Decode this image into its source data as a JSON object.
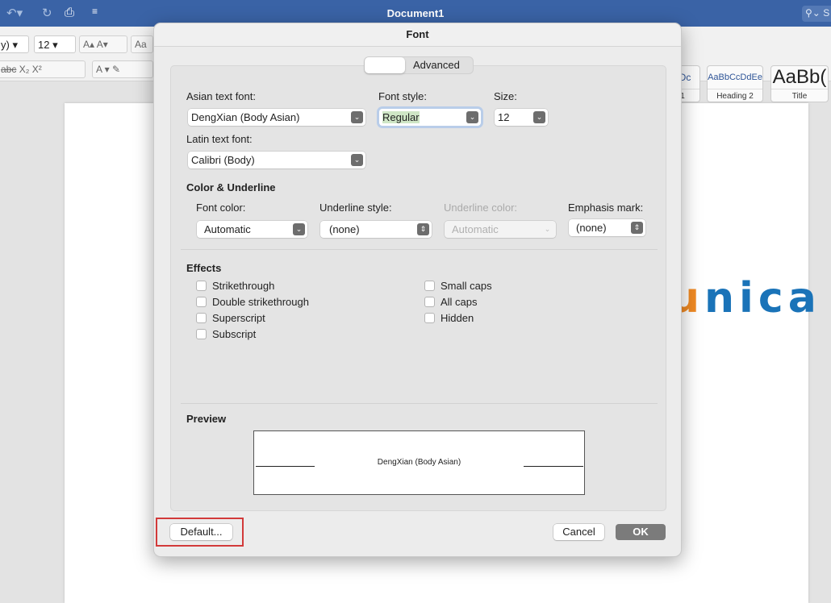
{
  "window": {
    "title": "Document1",
    "search_label": "S"
  },
  "ribbon": {
    "font_name_partial": "y)",
    "font_size": "12",
    "styles": [
      {
        "sample": "cDc",
        "name": "1"
      },
      {
        "sample": "AaBbCcDdEe",
        "name": "Heading 2"
      },
      {
        "sample": "AaBb(",
        "name": "Title"
      }
    ]
  },
  "logo": {
    "text": "unica",
    "colors": {
      "u": "#f08a24",
      "rest": "#1a73b8"
    }
  },
  "dialog": {
    "title": "Font",
    "tabs": [
      {
        "label": ""
      },
      {
        "label": "Advanced"
      }
    ],
    "asian_font": {
      "label": "Asian text font:",
      "value": "DengXian (Body Asian)"
    },
    "font_style": {
      "label": "Font style:",
      "value": "Regular"
    },
    "size": {
      "label": "Size:",
      "value": "12"
    },
    "latin_font": {
      "label": "Latin text font:",
      "value": "Calibri (Body)"
    },
    "color_section": {
      "title": "Color & Underline",
      "font_color": {
        "label": "Font color:",
        "value": "Automatic"
      },
      "underline_style": {
        "label": "Underline style:",
        "value": "(none)"
      },
      "underline_color": {
        "label": "Underline color:",
        "value": "Automatic",
        "disabled": true
      },
      "emphasis": {
        "label": "Emphasis mark:",
        "value": "(none)"
      }
    },
    "effects": {
      "title": "Effects",
      "left": [
        {
          "label": "Strikethrough",
          "checked": false
        },
        {
          "label": "Double strikethrough",
          "checked": false
        },
        {
          "label": "Superscript",
          "checked": false
        },
        {
          "label": "Subscript",
          "checked": false
        }
      ],
      "right": [
        {
          "label": "Small caps",
          "checked": false
        },
        {
          "label": "All caps",
          "checked": false
        },
        {
          "label": "Hidden",
          "checked": false
        }
      ]
    },
    "preview": {
      "title": "Preview",
      "text": "DengXian (Body Asian)"
    },
    "buttons": {
      "default": "Default...",
      "cancel": "Cancel",
      "ok": "OK"
    },
    "highlight_color": "#d23a3a"
  }
}
